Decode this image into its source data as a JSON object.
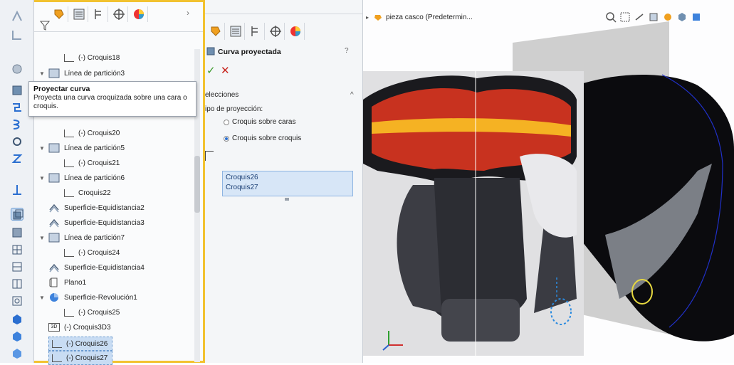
{
  "tree": {
    "rows": [
      {
        "label": "(-) Croquis18"
      },
      {
        "label": "Línea de partición3"
      },
      {
        "label": "(-) Croquis20"
      },
      {
        "label": "Línea de partición5"
      },
      {
        "label": "(-) Croquis21"
      },
      {
        "label": "Línea de partición6"
      },
      {
        "label": "Croquis22"
      },
      {
        "label": "Superficie-Equidistancia2"
      },
      {
        "label": "Superficie-Equidistancia3"
      },
      {
        "label": "Línea de partición7"
      },
      {
        "label": "(-) Croquis24"
      },
      {
        "label": "Superficie-Equidistancia4"
      },
      {
        "label": "Plano1"
      },
      {
        "label": "Superficie-Revolución1"
      },
      {
        "label": "(-) Croquis25"
      },
      {
        "label": "(-) Croquis3D3"
      },
      {
        "label": "(-) Croquis26"
      },
      {
        "label": "(-) Croquis27"
      }
    ],
    "badge_3d": "3D"
  },
  "tooltip": {
    "title": "Proyectar curva",
    "body": "Proyecta una curva croquizada sobre una cara o croquis."
  },
  "prop": {
    "title": "Curva proyectada",
    "help": "?",
    "ok": "✓",
    "cancel": "✕",
    "section": "elecciones",
    "collapse": "^",
    "proj_label": "ipo de proyección:",
    "option1": "Croquis sobre caras",
    "option2": "Croquis sobre croquis",
    "selections": [
      "Croquis26",
      "Croquis27"
    ]
  },
  "viewport": {
    "breadcrumb": "pieza casco (Predetermin..."
  },
  "colors": {
    "accent": "#f2c230",
    "selection": "#c8dcf3",
    "ok": "#3a9a2a",
    "cancel": "#c8261f"
  }
}
